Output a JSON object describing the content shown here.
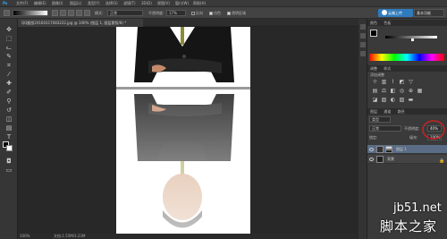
{
  "menubar": {
    "items": [
      "Ps",
      "文件(F)",
      "编辑(E)",
      "图像(I)",
      "图层(L)",
      "类型(Y)",
      "选择(S)",
      "滤镜(T)",
      "3D(D)",
      "视图(V)",
      "窗口(W)",
      "帮助(H)"
    ]
  },
  "options": {
    "mode_label": "模式:",
    "mode_value": "正常",
    "opacity_label": "不透明度:",
    "opacity_value": "17%",
    "reverse_label": "反向",
    "dither_label": "仿色",
    "transparency_label": "透明区域",
    "cloud_label": "云端上传",
    "workspace_label": "基本功能"
  },
  "document": {
    "tab_title": "QQ截图20160317083222.jpg @ 100% (图层 1, 图层蒙版/8) *"
  },
  "status": {
    "zoom": "100%",
    "doc_size": "文档:1.55M/3.23M"
  },
  "panels": {
    "color_tab": "颜色",
    "swatches_tab": "色板",
    "adjustments_tab": "调整",
    "styles_tab": "样式",
    "add_adjustment": "添加调整",
    "layers_tab": "图层",
    "channels_tab": "通道",
    "paths_tab": "路径",
    "filter_kind": "类型",
    "blend_mode": "正常",
    "opacity_label": "不透明度:",
    "opacity_value": "40%",
    "lock_label": "锁定:",
    "fill_label": "填充:",
    "fill_value": "100%",
    "layers": [
      {
        "name": "图层 1"
      },
      {
        "name": "背景"
      }
    ]
  },
  "watermark": {
    "site": "jb51.net",
    "brand": "脚本之家"
  },
  "colors": {
    "highlight_circle": "#cc2222",
    "selected_layer": "#5b6d86",
    "cloud_button": "#2f7bbd"
  }
}
